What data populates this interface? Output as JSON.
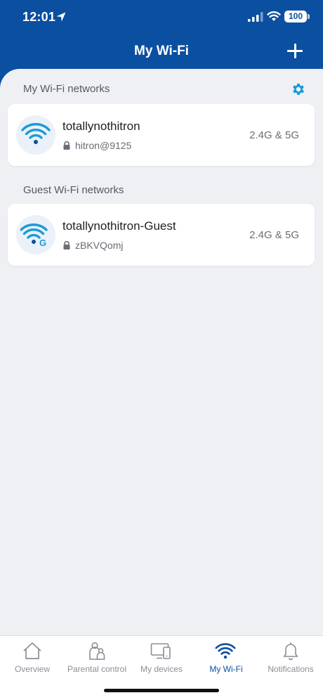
{
  "status_bar": {
    "time": "12:01",
    "battery": "100"
  },
  "header": {
    "title": "My Wi-Fi"
  },
  "sections": {
    "my_networks_title": "My Wi-Fi networks",
    "guest_networks_title": "Guest Wi-Fi networks"
  },
  "networks": [
    {
      "name": "totallynothitron",
      "password": "hitron@9125",
      "band": "2.4G & 5G",
      "icon": "wifi-icon"
    },
    {
      "name": "totallynothitron-Guest",
      "password": "zBKVQomj",
      "band": "2.4G & 5G",
      "icon": "wifi-guest-icon"
    }
  ],
  "tabs": [
    {
      "label": "Overview",
      "icon": "home-icon"
    },
    {
      "label": "Parental control",
      "icon": "parental-control-icon"
    },
    {
      "label": "My devices",
      "icon": "devices-icon"
    },
    {
      "label": "My Wi-Fi",
      "icon": "wifi-icon",
      "active": true
    },
    {
      "label": "Notifications",
      "icon": "bell-icon"
    }
  ],
  "colors": {
    "brand": "#0b4fa1",
    "accent": "#1a9bd7",
    "background": "#eef0f4"
  }
}
